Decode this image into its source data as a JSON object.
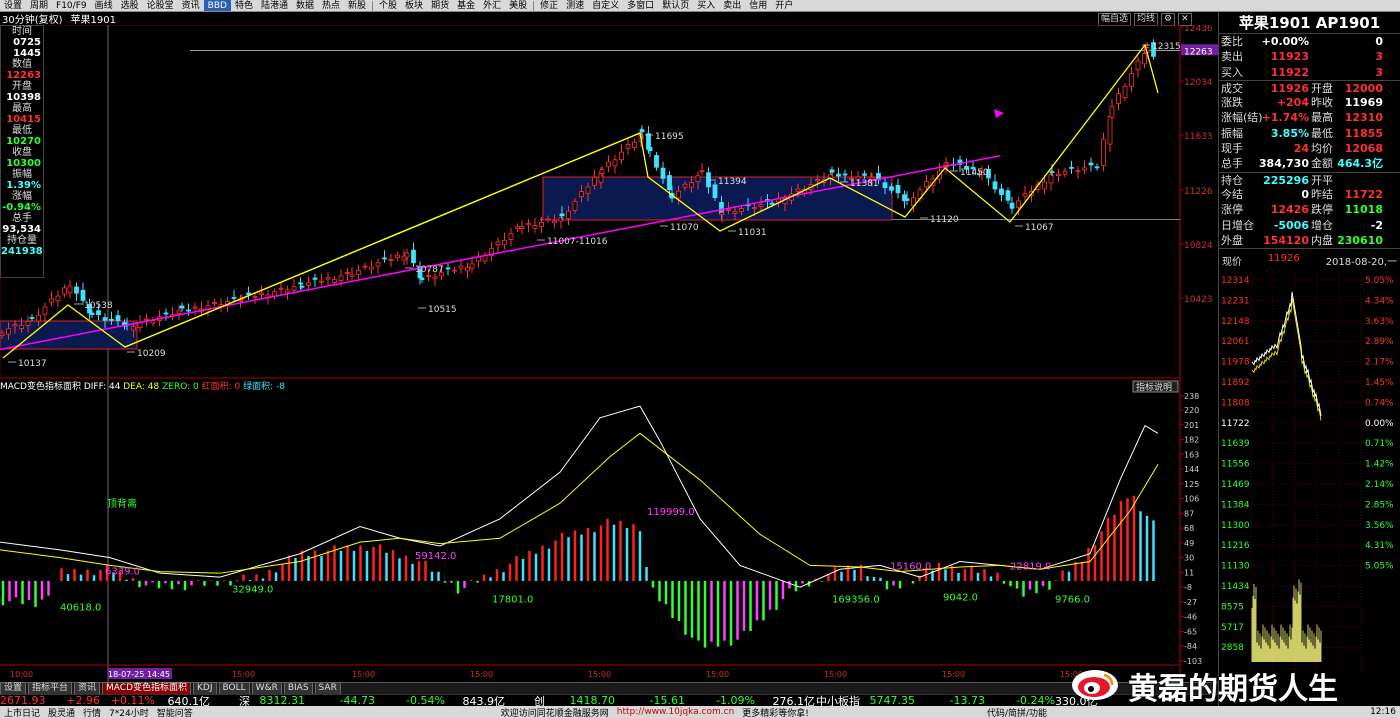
{
  "toolbar": [
    "设置",
    "周期",
    "F10/F9",
    "画线",
    "选股",
    "论股堂",
    "资讯",
    "BBD",
    "特色",
    "陆港通",
    "数据",
    "热点",
    "新股",
    "个股",
    "板块",
    "期货",
    "基金",
    "外汇",
    "美股",
    "修正",
    "测速",
    "自定义",
    "多窗口",
    "默认页",
    "买入",
    "卖出",
    "信用",
    "开户"
  ],
  "chart_header": {
    "period": "30分钟(复权)",
    "name": "苹果1901",
    "btns": [
      "幅自选",
      "均线",
      "⚙",
      "✕"
    ]
  },
  "left_info": [
    {
      "label": "时间",
      "value": "0725",
      "color": "#fff"
    },
    {
      "label": "",
      "value": "1445",
      "color": "#fff"
    },
    {
      "label": "数值",
      "value": "12263",
      "color": "#ff3030"
    },
    {
      "label": "开盘",
      "value": "10398",
      "color": "#fff"
    },
    {
      "label": "最高",
      "value": "10415",
      "color": "#ff3030"
    },
    {
      "label": "最低",
      "value": "10270",
      "color": "#30ff30"
    },
    {
      "label": "收盘",
      "value": "10300",
      "color": "#30ff30"
    },
    {
      "label": "振幅",
      "value": "1.39%",
      "color": "#40ffff"
    },
    {
      "label": "涨幅",
      "value": "-0.94%",
      "color": "#30ff30"
    },
    {
      "label": "总手",
      "value": "93,534",
      "color": "#fff"
    },
    {
      "label": "持仓量",
      "value": "241938",
      "color": "#40ffff"
    }
  ],
  "price_axis": [
    "12436",
    "12263",
    "12034",
    "11633",
    "11226",
    "10824",
    "10423"
  ],
  "price_annotations": [
    "12315",
    "11695",
    "11394",
    "11381",
    "11450",
    "11120",
    "11067",
    "11070",
    "11031",
    "11007-11016",
    "10787",
    "10515",
    "10538",
    "10209",
    "10137"
  ],
  "macd": {
    "title": "MACD变色指标面积",
    "diff_label": "DIFF:",
    "diff": "44",
    "dea_label": "DEA:",
    "dea": "48",
    "zero_label": "ZERO:",
    "zero": "0",
    "red_label": "红面积:",
    "red": "0",
    "green_label": "绿面积:",
    "green": "-8",
    "help": "指标说明",
    "axis": [
      "238",
      "220",
      "201",
      "182",
      "163",
      "144",
      "125",
      "106",
      "87",
      "68",
      "49",
      "30",
      "11",
      "-8",
      "-27",
      "-46",
      "-65",
      "-84",
      "-103"
    ],
    "labels": [
      "顶背离",
      "6339.0",
      "40618.0",
      "32949.0",
      "59142.0",
      "17801.0",
      "119999.0",
      "169356.0",
      "15160.0",
      "9042.0",
      "22819.0",
      "9766.0"
    ]
  },
  "time_axis": [
    "10:00",
    "18-07-25 14:45",
    "15:00",
    "15:00",
    "15:00",
    "15:00",
    "15:00",
    "15:00",
    "15:00",
    "15:00"
  ],
  "right": {
    "title": "苹果1901 AP1901",
    "quote": [
      [
        "委比",
        "+0.00%",
        "",
        "0"
      ],
      [
        "卖出",
        "11923",
        "",
        "3"
      ],
      [
        "买入",
        "11922",
        "",
        "3"
      ],
      [
        "成交",
        "11926",
        "开盘",
        "12000"
      ],
      [
        "涨跌",
        "+204",
        "昨收",
        "11969"
      ],
      [
        "涨幅(结)",
        "+1.74%",
        "最高",
        "12310"
      ],
      [
        "振幅",
        "3.85%",
        "最低",
        "11855"
      ],
      [
        "现手",
        "24",
        "均价",
        "12068"
      ],
      [
        "总手",
        "384,730",
        "金额",
        "464.3亿"
      ],
      [
        "持仓",
        "225296",
        "开平",
        ""
      ],
      [
        "今结",
        "0",
        "昨结",
        "11722"
      ],
      [
        "涨停",
        "12426",
        "跌停",
        "11018"
      ],
      [
        "日增仓",
        "-5006",
        "增仓",
        "-2"
      ],
      [
        "外盘",
        "154120",
        "内盘",
        "230610"
      ]
    ],
    "mini": {
      "label": "现价",
      "price": "11926",
      "date": "2018-08-20,一",
      "axis_left": [
        "12314",
        "12231",
        "12148",
        "12061",
        "11978",
        "11892",
        "11808",
        "11722",
        "11639",
        "11556",
        "11469",
        "11384",
        "11300",
        "11216",
        "11130",
        "11434",
        "8575",
        "5717",
        "2858"
      ],
      "axis_right": [
        "5.05%",
        "4.34%",
        "3.63%",
        "2.89%",
        "2.17%",
        "1.45%",
        "0.74%",
        "0.00%",
        "0.71%",
        "1.42%",
        "2.14%",
        "2.85%",
        "3.56%",
        "4.31%",
        "5.05%"
      ]
    }
  },
  "tabs": [
    "设置",
    "指标平台",
    "资讯",
    "MACD变色指标面积",
    "KDJ",
    "BOLL",
    "W&R",
    "BIAS",
    "SAR"
  ],
  "ticker": [
    "2671.93",
    "+2.96",
    "+0.11%",
    "640.1亿",
    "深",
    "8312.31",
    "-44.73",
    "-0.54%",
    "843.9亿",
    "创",
    "1418.70",
    "-15.61",
    "-1.09%",
    "276.1亿",
    "中小板指",
    "5747.35",
    "-13.73",
    "-0.24%",
    "330.0亿"
  ],
  "status": [
    "上市日记",
    "股灵通",
    "行情",
    "7*24小时",
    "智能问答",
    "欢迎访问同花顺金融服务网",
    "http://www.10jqka.com.cn",
    "更多精彩等你拿!",
    "代码/简拼/功能",
    "12:16"
  ],
  "watermark": "黄磊的期货人生",
  "colors": {
    "up": "#ff3030",
    "down": "#40e0ff",
    "yellow": "#ffff00",
    "magenta": "#ff00ff",
    "box": "#0a1a50"
  }
}
